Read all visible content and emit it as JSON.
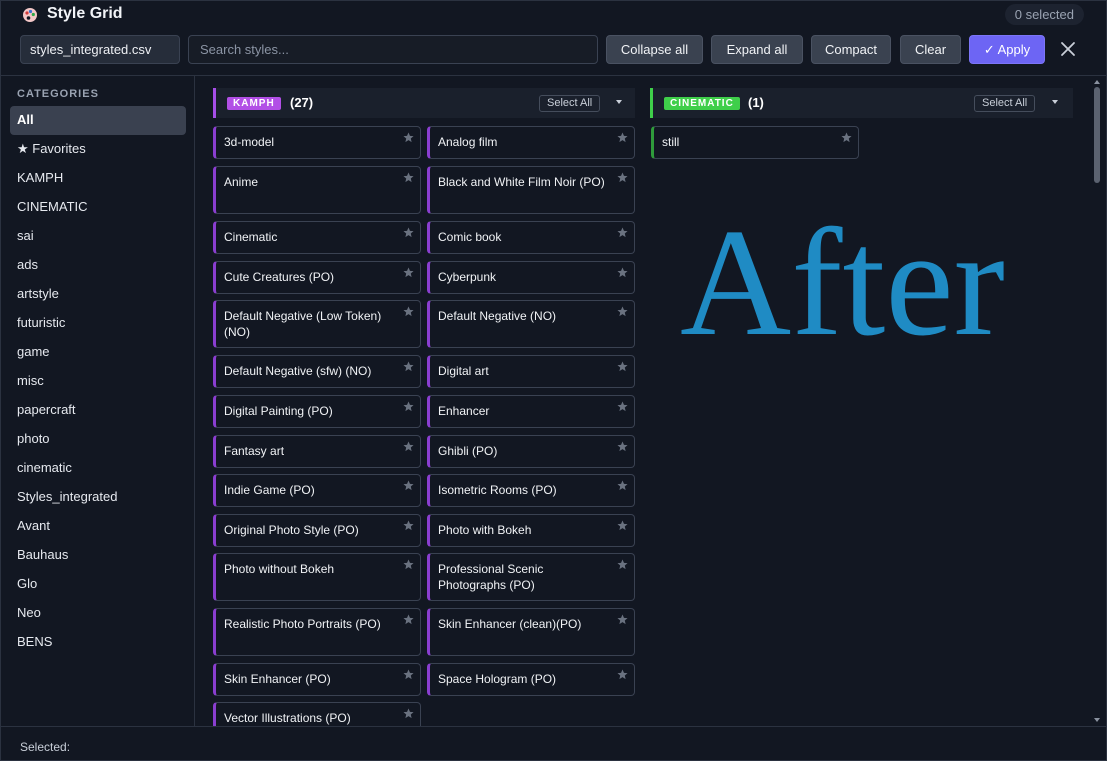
{
  "header": {
    "title": "Style Grid",
    "title_icon": "palette-icon",
    "selected_count": "0 selected"
  },
  "toolbar": {
    "csv_file": "styles_integrated.csv",
    "search_placeholder": "Search styles...",
    "collapse_all": "Collapse all",
    "expand_all": "Expand all",
    "compact": "Compact",
    "clear": "Clear",
    "apply": "✓ Apply",
    "apply_color": "#6d65f4"
  },
  "sidebar": {
    "heading": "CATEGORIES",
    "items": [
      "All",
      "★ Favorites",
      "KAMPH",
      "CINEMATIC",
      "sai",
      "ads",
      "artstyle",
      "futuristic",
      "game",
      "misc",
      "papercraft",
      "photo",
      "cinematic",
      "Styles_integrated",
      "Avant",
      "Bauhaus",
      "Glo",
      "Neo",
      "BENS"
    ]
  },
  "groups": {
    "kamph": {
      "tag": "KAMPH",
      "count": "(27)",
      "color": "#a64ee8",
      "select_all": "Select All",
      "styles": [
        "3d-model",
        "Analog film",
        "Anime",
        "Black and White Film Noir (PO)",
        "Cinematic",
        "Comic book",
        "Cute Creatures (PO)",
        "Cyberpunk",
        "Default Negative (Low Token) (NO)",
        "Default Negative (NO)",
        "Default Negative (sfw) (NO)",
        "Digital art",
        "Digital Painting (PO)",
        "Enhancer",
        "Fantasy art",
        "Ghibli (PO)",
        "Indie Game (PO)",
        "Isometric Rooms (PO)",
        "Original Photo Style (PO)",
        "Photo with Bokeh",
        "Photo without Bokeh",
        "Professional Scenic Photographs (PO)",
        "Realistic Photo Portraits (PO)",
        "Skin Enhancer (clean)(PO)",
        "Skin Enhancer (PO)",
        "Space Hologram (PO)",
        "Vector Illustrations (PO)"
      ]
    },
    "cinematic": {
      "tag": "CINEMATIC",
      "count": "(1)",
      "color": "#3fcf4a",
      "select_all": "Select All",
      "styles": [
        "still"
      ]
    }
  },
  "watermark": "After",
  "footer": {
    "label": "Selected:"
  }
}
